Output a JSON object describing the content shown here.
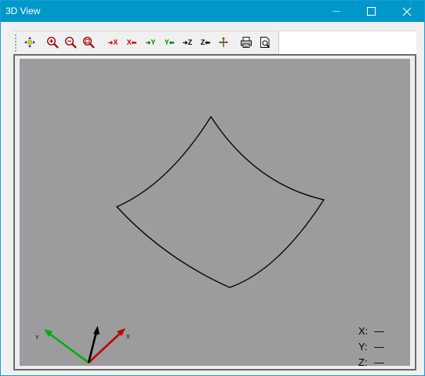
{
  "window": {
    "title": "3D View"
  },
  "toolbar": {
    "tools": [
      {
        "icon": "pan-icon"
      },
      {
        "icon": "zoom-in-icon"
      },
      {
        "icon": "zoom-out-icon"
      },
      {
        "icon": "zoom-fit-icon"
      },
      {
        "label": "+X",
        "color": "#d00000"
      },
      {
        "label": "X+",
        "color": "#d00000"
      },
      {
        "label": "+Y",
        "color": "#008000"
      },
      {
        "label": "Y+",
        "color": "#008000"
      },
      {
        "label": "+Z",
        "color": "#000000"
      },
      {
        "label": "Z+",
        "color": "#000000"
      },
      {
        "icon": "rotate-icon"
      },
      {
        "icon": "print-icon"
      },
      {
        "icon": "print-preview-icon"
      }
    ]
  },
  "viewport": {
    "background": "#9c9b9e",
    "axes": {
      "x_label": "X",
      "y_label": "Y",
      "z_label": "Z",
      "x_color": "#c00000",
      "y_color": "#00b000",
      "z_color": "#000000"
    },
    "coords": {
      "x_label": "X:",
      "x_value": "—",
      "y_label": "Y:",
      "y_value": "—",
      "z_label": "Z:",
      "z_value": "—"
    }
  }
}
